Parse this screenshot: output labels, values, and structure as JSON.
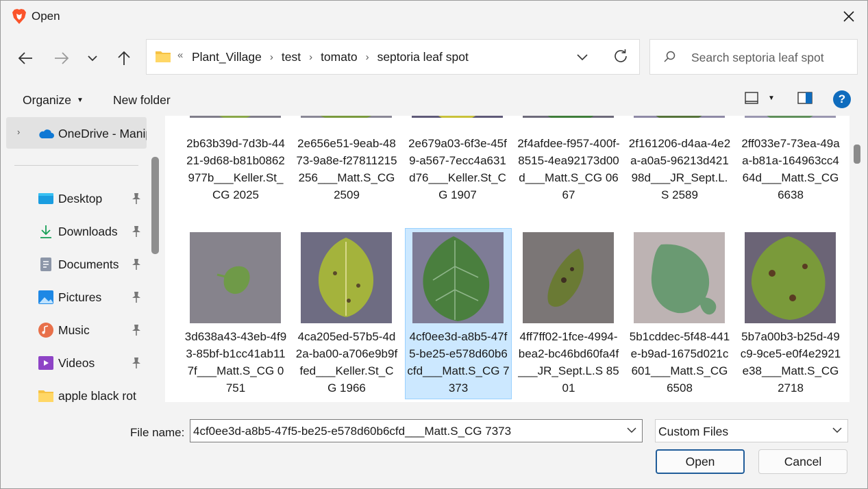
{
  "window": {
    "title": "Open",
    "app_icon": "brave-lion-icon",
    "close_icon": "close-icon"
  },
  "nav": {
    "back_icon": "arrow-left-icon",
    "forward_icon": "arrow-right-icon",
    "recent_icon": "chevron-down-icon",
    "up_icon": "arrow-up-icon"
  },
  "address": {
    "overflow": "«",
    "crumbs": [
      "Plant_Village",
      "test",
      "tomato",
      "septoria leaf spot"
    ],
    "separator": "›",
    "refresh_icon": "refresh-icon"
  },
  "search": {
    "placeholder": "Search septoria leaf spot"
  },
  "toolbar": {
    "organize": "Organize",
    "new_folder": "New folder",
    "help": "?"
  },
  "sidebar": {
    "onedrive": "OneDrive - Manipal",
    "items": [
      {
        "label": "Desktop",
        "icon": "desktop-icon"
      },
      {
        "label": "Downloads",
        "icon": "download-icon"
      },
      {
        "label": "Documents",
        "icon": "documents-icon"
      },
      {
        "label": "Pictures",
        "icon": "pictures-icon"
      },
      {
        "label": "Music",
        "icon": "music-icon"
      },
      {
        "label": "Videos",
        "icon": "videos-icon"
      },
      {
        "label": "apple black rot",
        "icon": "folder-icon"
      }
    ]
  },
  "files": [
    {
      "name": "2b63b39d-7d3b-4421-9d68-b81b0862977b___Keller.St_CG 2025",
      "selected": false
    },
    {
      "name": "2e656e51-9eab-4873-9a8e-f27811215256___Matt.S_CG 2509",
      "selected": false
    },
    {
      "name": "2e679a03-6f3e-45f9-a567-7ecc4a631d76___Keller.St_CG 1907",
      "selected": false
    },
    {
      "name": "2f4afdee-f957-400f-8515-4ea92173d00d___Matt.S_CG 0667",
      "selected": false
    },
    {
      "name": "2f161206-d4aa-4e2a-a0a5-96213d42198d___JR_Sept.L.S 2589",
      "selected": false
    },
    {
      "name": "2ff033e7-73ea-49aa-b81a-164963cc464d___Matt.S_CG 6638",
      "selected": false
    },
    {
      "name": "3d638a43-43eb-4f93-85bf-b1cc41ab117f___Matt.S_CG 0751",
      "selected": false
    },
    {
      "name": "4ca205ed-57b5-4d2a-ba00-a706e9b9ffed___Keller.St_CG 1966",
      "selected": false
    },
    {
      "name": "4cf0ee3d-a8b5-47f5-be25-e578d60b6cfd___Matt.S_CG 7373",
      "selected": true
    },
    {
      "name": "4ff7ff02-1fce-4994-bea2-bc46bd60fa4f___JR_Sept.L.S 8501",
      "selected": false
    },
    {
      "name": "5b1cddec-5f48-441e-b9ad-1675d021c601___Matt.S_CG 6508",
      "selected": false
    },
    {
      "name": "5b7a00b3-b25d-49c9-9ce5-e0f4e2921e38___Matt.S_CG 2718",
      "selected": false
    }
  ],
  "footer": {
    "file_name_label": "File name:",
    "file_name_value": "4cf0ee3d-a8b5-47f5-be25-e578d60b6cfd___Matt.S_CG 7373",
    "file_type": "Custom Files",
    "open_button": "Open",
    "cancel_button": "Cancel"
  },
  "colors": {
    "accent": "#0f6cbd",
    "selection": "#cce8ff",
    "selection_border": "#99d1ff",
    "background": "#f3f3f3"
  }
}
